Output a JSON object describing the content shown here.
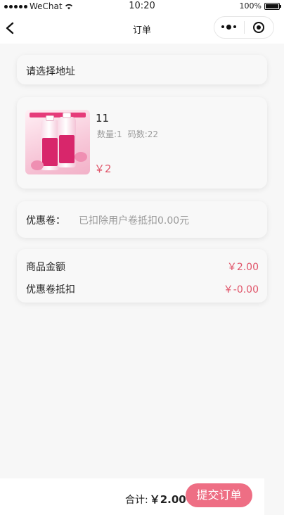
{
  "status_bar": {
    "carrier": "WeChat",
    "time": "10:20",
    "battery_text": "100%",
    "battery_level": 1.0
  },
  "nav": {
    "title": "订单",
    "back_icon": "chevron-left-icon",
    "more_icon": "more-dots-icon",
    "close_icon": "target-circle-icon"
  },
  "address": {
    "placeholder": "请选择地址"
  },
  "goods": {
    "name": "11",
    "quantity_label": "数量:1",
    "size_label": "码数:22",
    "price": "￥2"
  },
  "coupon": {
    "label": "优惠卷：",
    "value": "已扣除用户卷抵扣0.00元"
  },
  "summary": {
    "goods_amount_label": "商品金额",
    "goods_amount_value": "￥2.00",
    "discount_label": "优惠卷抵扣",
    "discount_value": "￥-0.00"
  },
  "footer": {
    "total_label": "合计:",
    "total_value": "￥2.00",
    "submit_label": "提交订单"
  },
  "colors": {
    "accent": "#ee6e84",
    "price": "#e0556a",
    "muted": "#9a9a9a",
    "background": "#f7f7f7"
  }
}
